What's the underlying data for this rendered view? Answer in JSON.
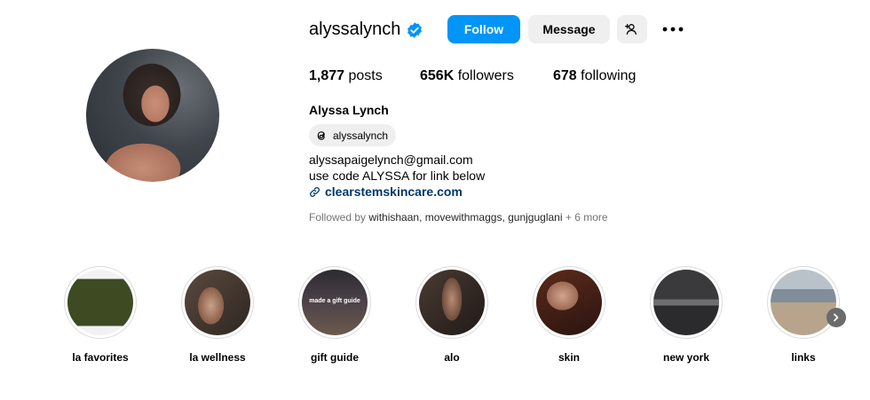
{
  "profile": {
    "username": "alyssalynch",
    "verified_icon": "verified-badge-icon",
    "buttons": {
      "follow": "Follow",
      "message": "Message",
      "add_user_icon": "add-user-icon",
      "more_icon": "more-dots-icon"
    },
    "stats": {
      "posts_count": "1,877",
      "posts_label": "posts",
      "followers_count": "656K",
      "followers_label": "followers",
      "following_count": "678",
      "following_label": "following"
    },
    "full_name": "Alyssa Lynch",
    "threads_handle": "alyssalynch",
    "bio": [
      "alyssapaigelynch@gmail.com",
      "use code ALYSSA for link below"
    ],
    "link": "clearstemskincare.com",
    "followed_by": {
      "prefix": "Followed by",
      "names": "withishaan, movewithmaggs, gunjguglani",
      "more": "+ 6 more"
    }
  },
  "highlights": [
    {
      "label": "la favorites"
    },
    {
      "label": "la wellness"
    },
    {
      "label": "gift guide",
      "overlay_text": "made a gift guide"
    },
    {
      "label": "alo"
    },
    {
      "label": "skin"
    },
    {
      "label": "new york"
    },
    {
      "label": "links"
    }
  ],
  "colors": {
    "follow_blue": "#0095f6",
    "link_blue": "#00376b",
    "button_gray": "#efefef",
    "muted_text": "#737373"
  }
}
